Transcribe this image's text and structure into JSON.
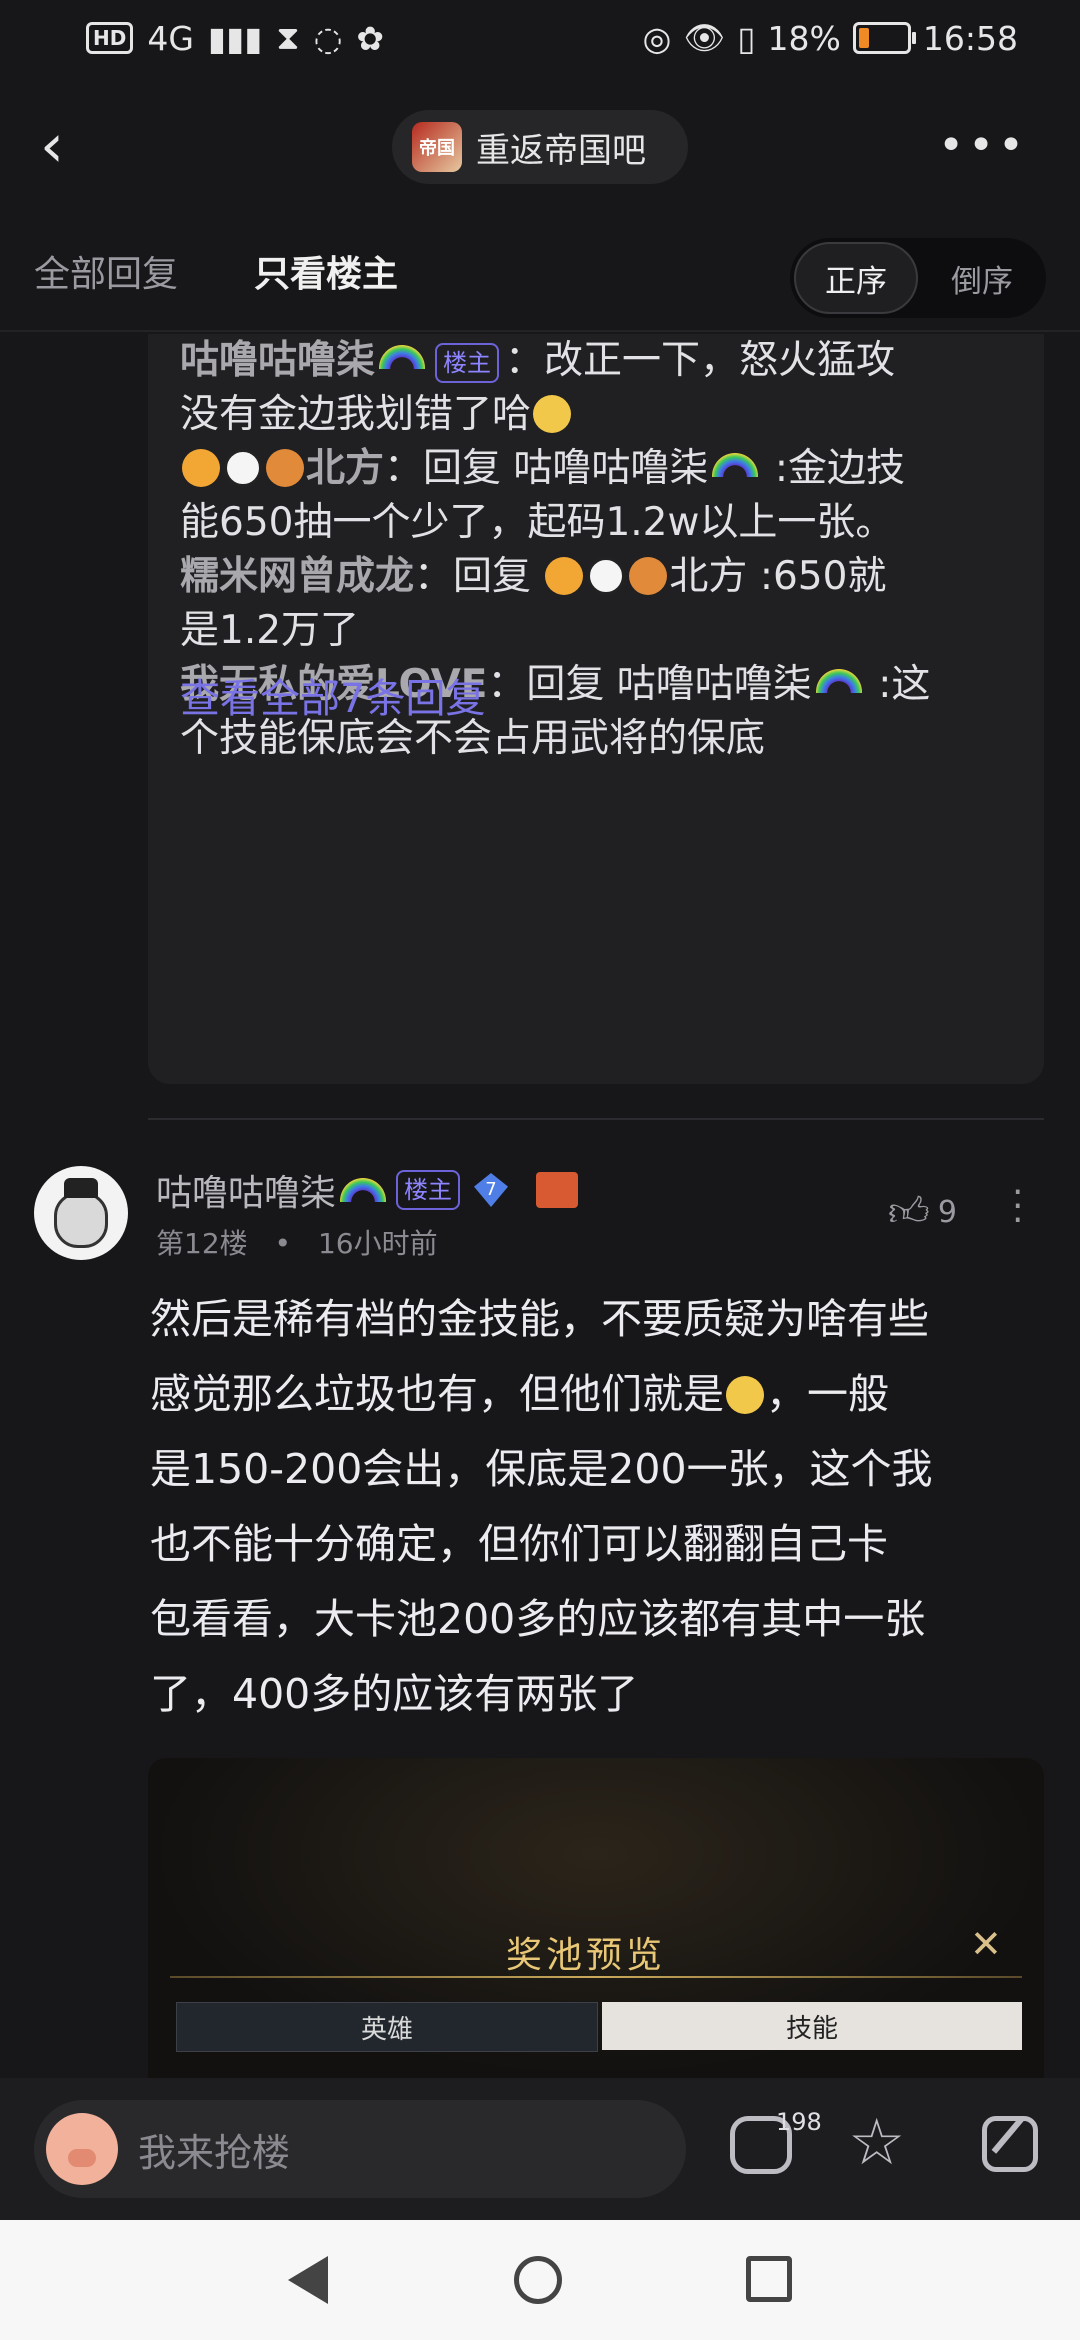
{
  "status": {
    "time": "16:58",
    "battery": "18%",
    "network": "4G"
  },
  "header": {
    "forum": "重返帝国吧",
    "logo_text": "帝国"
  },
  "tabs": {
    "all": "全部回复",
    "op_only": "只看楼主",
    "asc": "正序",
    "desc": "倒序"
  },
  "replies": {
    "r1": {
      "name": "咕噜咕噜柒",
      "tag": "楼主",
      "text1": "：改正一下，怒火猛攻",
      "text2": "没有金边我划错了哈"
    },
    "r2": {
      "name": "北方",
      "text1": "：回复 咕噜咕噜柒",
      "text1b": " :金边技",
      "text2": "能650抽一个少了，起码1.2w以上一张。"
    },
    "r3": {
      "name": "糯米网曾成龙",
      "text1": "：回复 ",
      "text1b": "北方 :650就",
      "text2": "是1.2万了"
    },
    "r4": {
      "name": "我无私的爱LOVE",
      "text1": "：回复 咕噜咕噜柒",
      "text1b": " :这",
      "text2": "个技能保底会不会占用武将的保底"
    },
    "view_all": "查看全部7条回复"
  },
  "post": {
    "author": "咕噜咕噜柒",
    "tag": "楼主",
    "level": "7",
    "floor": "第12楼",
    "dot": "•",
    "time": "16小时前",
    "likes": "9",
    "body_lines": [
      "然后是稀有档的金技能，不要质疑为啥有些",
      "感觉那么垃圾也有，但他们就是",
      "是150-200会出，保底是200一张，这个我",
      "也不能十分确定，但你们可以翻翻自己卡",
      "包看看，大卡池200多的应该都有其中一张",
      "了，400多的应该有两张了"
    ],
    "body_line2_tail": "，一般",
    "image": {
      "title": "奖池预览",
      "tab_hero": "英雄",
      "tab_skill": "技能"
    }
  },
  "bottom": {
    "placeholder": "我来抢楼",
    "comment_count": "198"
  },
  "colors": {
    "accent": "#7a73e6",
    "bg": "#17171a",
    "tag": "#8d84ff"
  }
}
